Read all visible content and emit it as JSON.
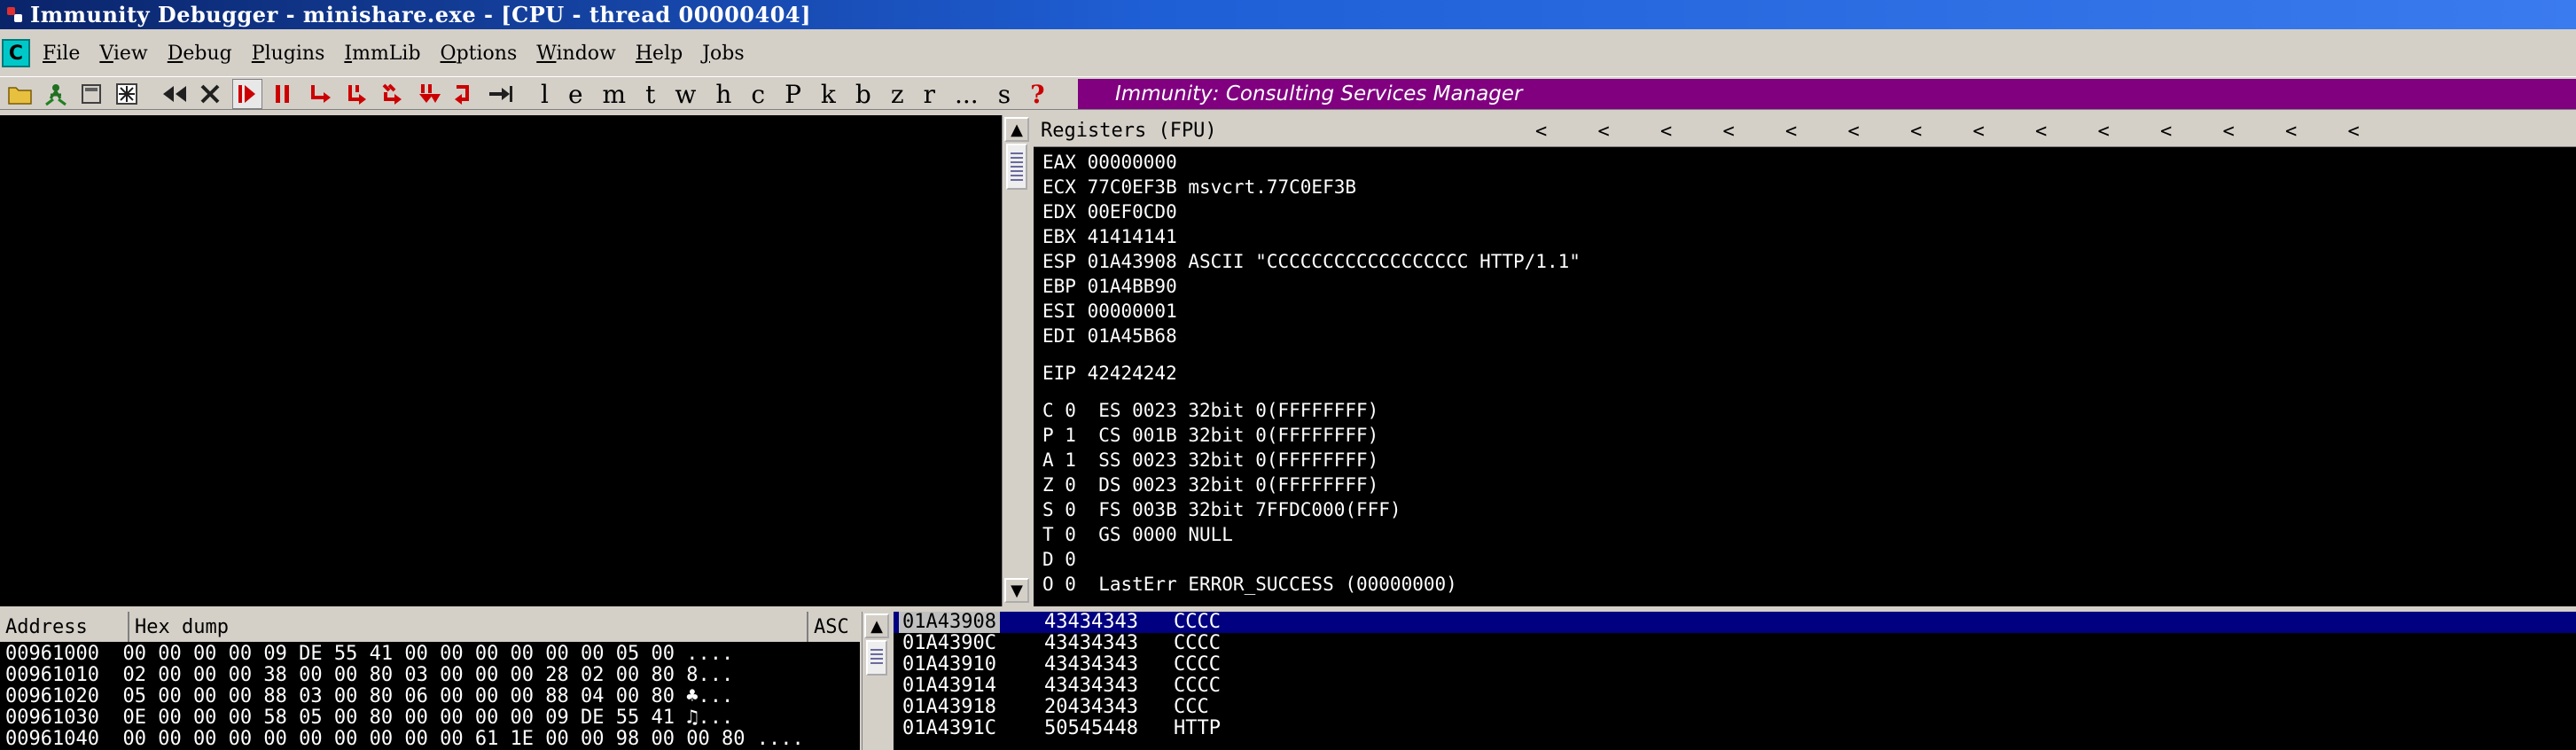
{
  "window": {
    "title": "Immunity Debugger - minishare.exe - [CPU - thread 00000404]"
  },
  "menubar": {
    "cpu_icon_label": "C",
    "items": [
      {
        "accel": "F",
        "rest": "ile"
      },
      {
        "accel": "V",
        "rest": "iew"
      },
      {
        "accel": "D",
        "rest": "ebug"
      },
      {
        "accel": "P",
        "rest": "lugins"
      },
      {
        "accel": "I",
        "rest": "mmLib"
      },
      {
        "accel": "O",
        "rest": "ptions"
      },
      {
        "accel": "W",
        "rest": "indow"
      },
      {
        "accel": "H",
        "rest": "elp"
      },
      {
        "accel": "J",
        "rest": "obs"
      }
    ]
  },
  "toolbar": {
    "icons": [
      "open-icon",
      "restart-icon",
      "close-icon",
      "attach-icon",
      "rewind-icon",
      "stop-icon",
      "run-icon",
      "pause-icon",
      "step-into-icon",
      "step-over-icon",
      "trace-into-icon",
      "trace-over-icon",
      "execute-till-return-icon",
      "go-to-icon"
    ],
    "letters": [
      "l",
      "e",
      "m",
      "t",
      "w",
      "h",
      "c",
      "P",
      "k",
      "b",
      "z",
      "r",
      "...",
      "s"
    ],
    "help": "?",
    "banner": "Immunity: Consulting Services Manager"
  },
  "registers": {
    "header": "Registers (FPU)",
    "arrows": [
      "<",
      "<",
      "<",
      "<",
      "<",
      "<",
      "<",
      "<",
      "<",
      "<",
      "<",
      "<",
      "<",
      "<"
    ],
    "general": [
      "EAX 00000000",
      "ECX 77C0EF3B msvcrt.77C0EF3B",
      "EDX 00EF0CD0",
      "EBX 41414141",
      "ESP 01A43908 ASCII \"CCCCCCCCCCCCCCCCCC HTTP/1.1\"",
      "EBP 01A4BB90",
      "ESI 00000001",
      "EDI 01A45B68"
    ],
    "eip": "EIP 42424242",
    "flags": [
      "C 0  ES 0023 32bit 0(FFFFFFFF)",
      "P 1  CS 001B 32bit 0(FFFFFFFF)",
      "A 1  SS 0023 32bit 0(FFFFFFFF)",
      "Z 0  DS 0023 32bit 0(FFFFFFFF)",
      "S 0  FS 003B 32bit 7FFDC000(FFF)",
      "T 0  GS 0000 NULL",
      "D 0",
      "O 0  LastErr ERROR_SUCCESS (00000000)"
    ]
  },
  "dump": {
    "headers": {
      "address": "Address",
      "hex": "Hex dump",
      "ascii": "ASC"
    },
    "rows": [
      {
        "address": "00961000",
        "hex": "00 00 00 00 09 DE 55 41 00 00 00 00 00 00 05 00",
        "ascii": "...."
      },
      {
        "address": "00961010",
        "hex": "02 00 00 00 38 00 00 80 03 00 00 00 28 02 00 80",
        "ascii": "8..."
      },
      {
        "address": "00961020",
        "hex": "05 00 00 00 88 03 00 80 06 00 00 00 88 04 00 80",
        "ascii": "♣..."
      },
      {
        "address": "00961030",
        "hex": "0E 00 00 00 58 05 00 80 00 00 00 00 09 DE 55 41",
        "ascii": "♫..."
      },
      {
        "address": "00961040",
        "hex": "00 00 00 00 00 00 00 00 00 00 61 1E 00 00 98 00 00 80",
        "ascii": "...."
      }
    ]
  },
  "stack": {
    "rows": [
      {
        "address": "01A43908",
        "value": "43434343",
        "comment": "CCCC"
      },
      {
        "address": "01A4390C",
        "value": "43434343",
        "comment": "CCCC"
      },
      {
        "address": "01A43910",
        "value": "43434343",
        "comment": "CCCC"
      },
      {
        "address": "01A43914",
        "value": "43434343",
        "comment": "CCCC"
      },
      {
        "address": "01A43918",
        "value": "20434343",
        "comment": "CCC"
      },
      {
        "address": "01A4391C",
        "value": "50545448",
        "comment": "HTTP"
      }
    ]
  }
}
